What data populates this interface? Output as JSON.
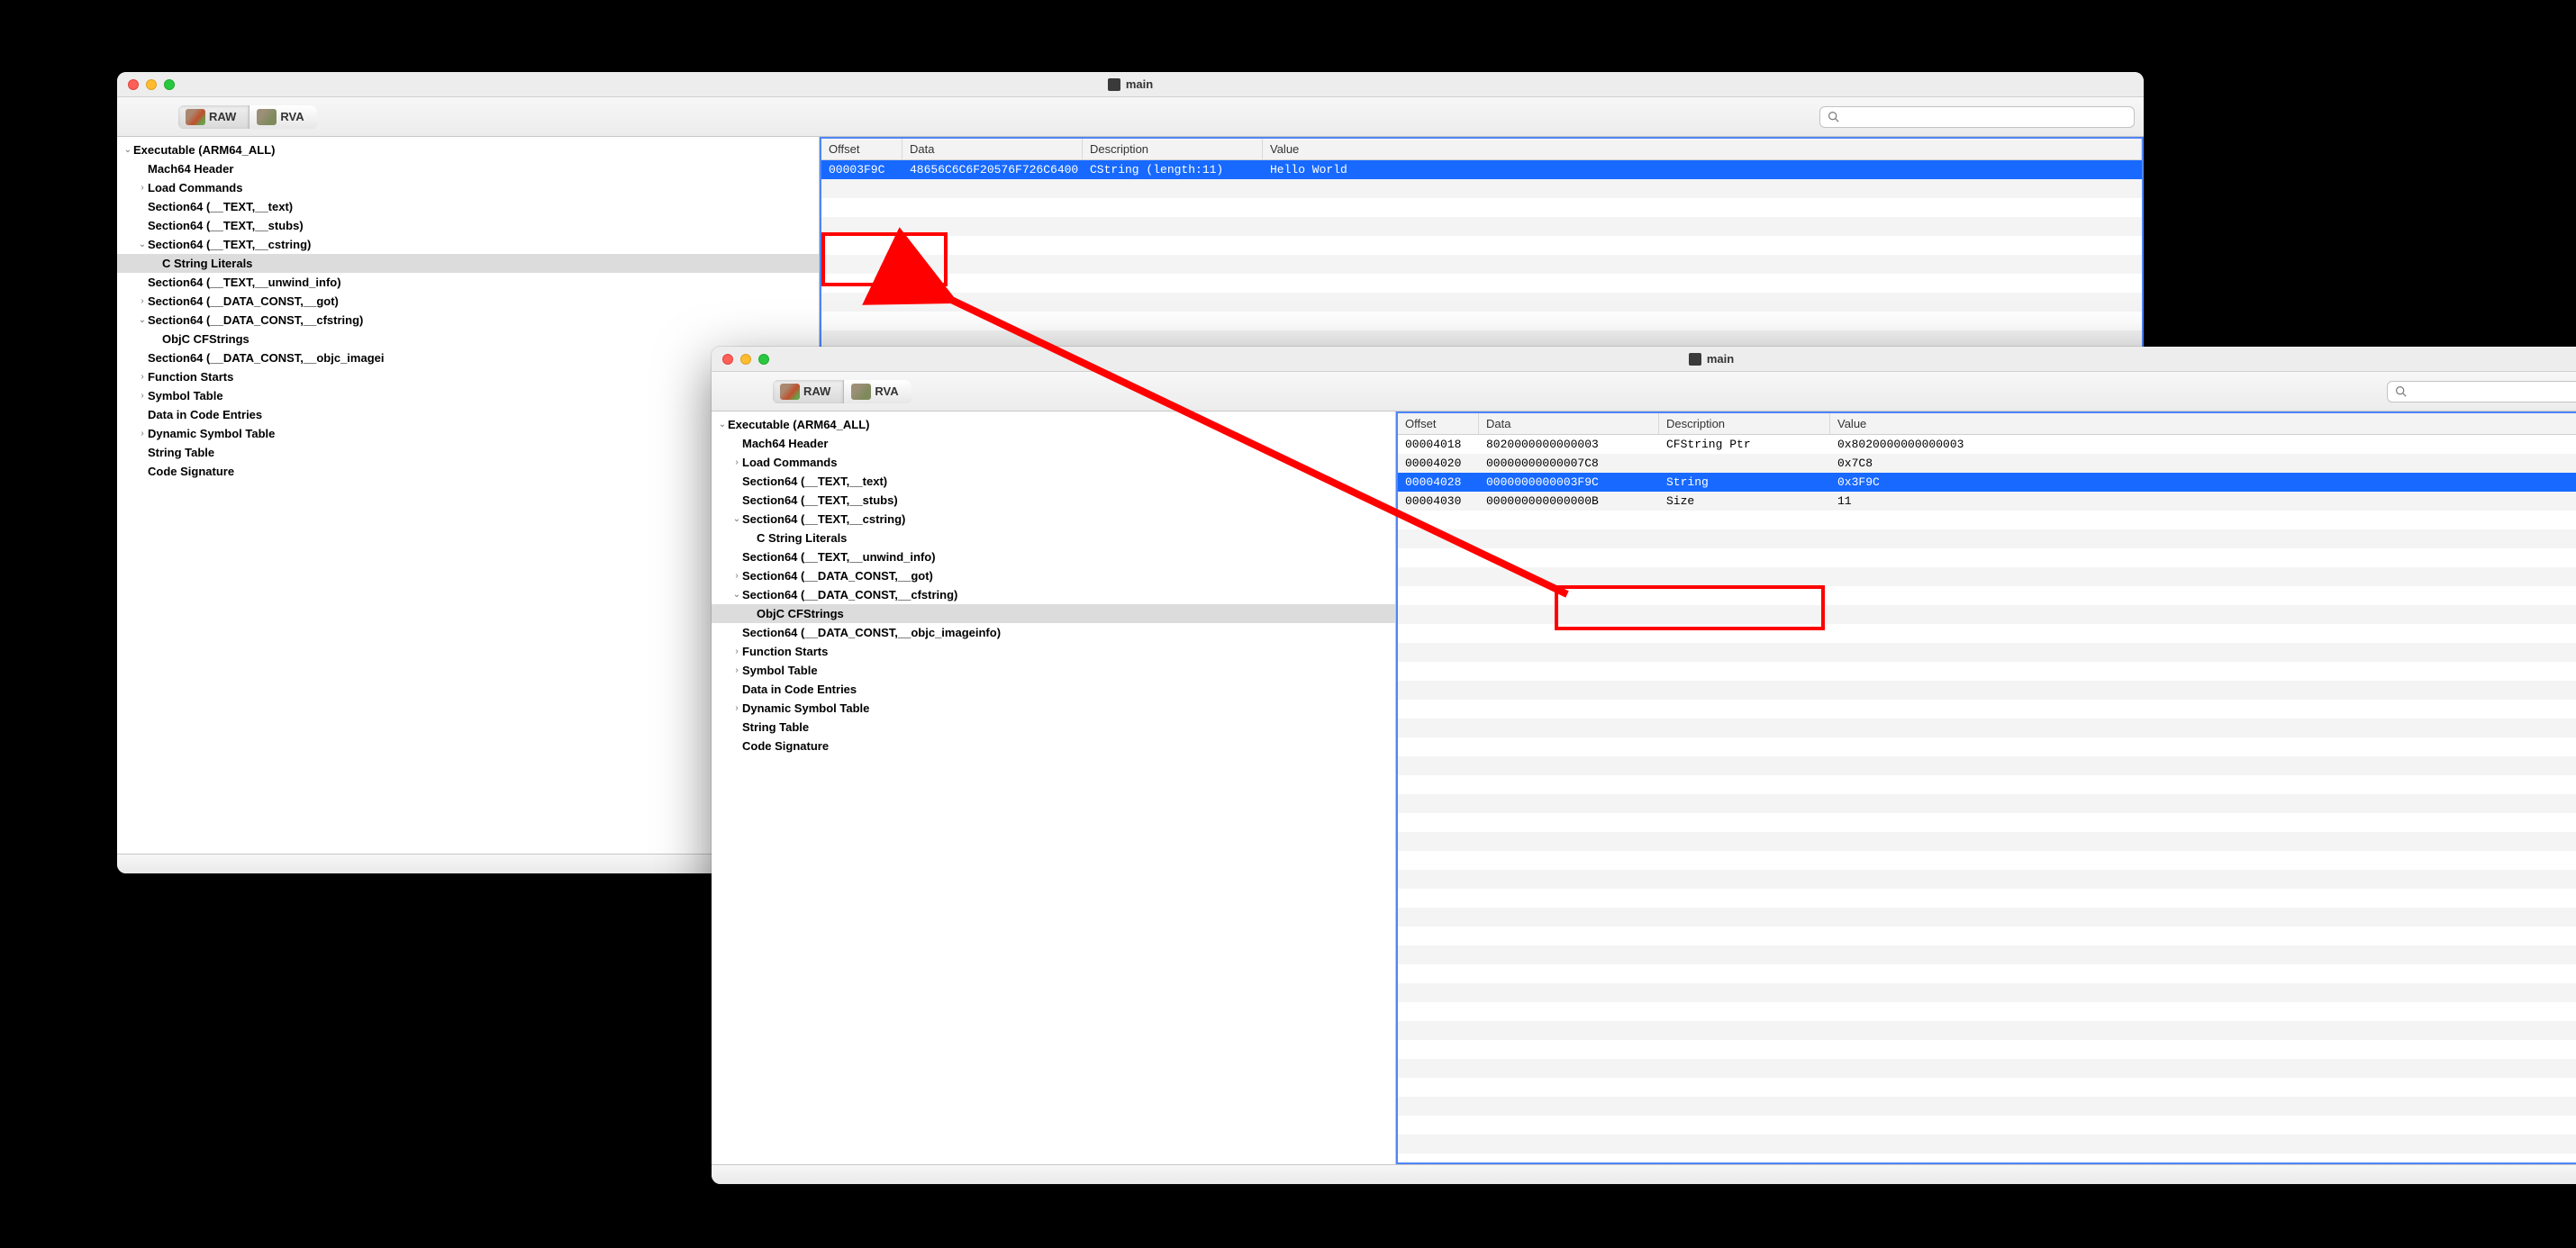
{
  "window_title": "main",
  "toolbar": {
    "raw_label": "RAW",
    "rva_label": "RVA"
  },
  "search": {
    "placeholder": ""
  },
  "columns": {
    "offset": "Offset",
    "data": "Data",
    "description": "Description",
    "value": "Value"
  },
  "tree": {
    "root": "Executable  (ARM64_ALL)",
    "mach64_header": "Mach64 Header",
    "load_commands": "Load Commands",
    "sec_text_text": "Section64 (__TEXT,__text)",
    "sec_text_stubs": "Section64 (__TEXT,__stubs)",
    "sec_text_cstring": "Section64 (__TEXT,__cstring)",
    "c_string_literals": "C String Literals",
    "sec_text_unwind": "Section64 (__TEXT,__unwind_info)",
    "sec_dataconst_got": "Section64 (__DATA_CONST,__got)",
    "sec_dataconst_cfstring": "Section64 (__DATA_CONST,__cfstring)",
    "objc_cfstrings": "ObjC CFStrings",
    "sec_dataconst_objcimageinfo_trunc": "Section64 (__DATA_CONST,__objc_imagei",
    "sec_dataconst_objcimageinfo": "Section64 (__DATA_CONST,__objc_imageinfo)",
    "function_starts": "Function Starts",
    "symbol_table": "Symbol Table",
    "data_in_code": "Data in Code Entries",
    "dynamic_symbol_table": "Dynamic Symbol Table",
    "string_table": "String Table",
    "code_signature": "Code Signature"
  },
  "win1_rows": [
    {
      "offset": "00003F9C",
      "data": "48656C6C6F20576F726C6400",
      "desc": "CString (length:11)",
      "value": "Hello World",
      "sel": true
    }
  ],
  "win2_rows": [
    {
      "offset": "00004018",
      "data": "8020000000000003",
      "desc": "CFString Ptr",
      "value": "0x8020000000000003",
      "sel": false
    },
    {
      "offset": "00004020",
      "data": "00000000000007C8",
      "desc": "",
      "value": "0x7C8",
      "sel": false
    },
    {
      "offset": "00004028",
      "data": "0000000000003F9C",
      "desc": "String",
      "value": "0x3F9C",
      "sel": true
    },
    {
      "offset": "00004030",
      "data": "000000000000000B",
      "desc": "Size",
      "value": "11",
      "sel": false
    }
  ]
}
